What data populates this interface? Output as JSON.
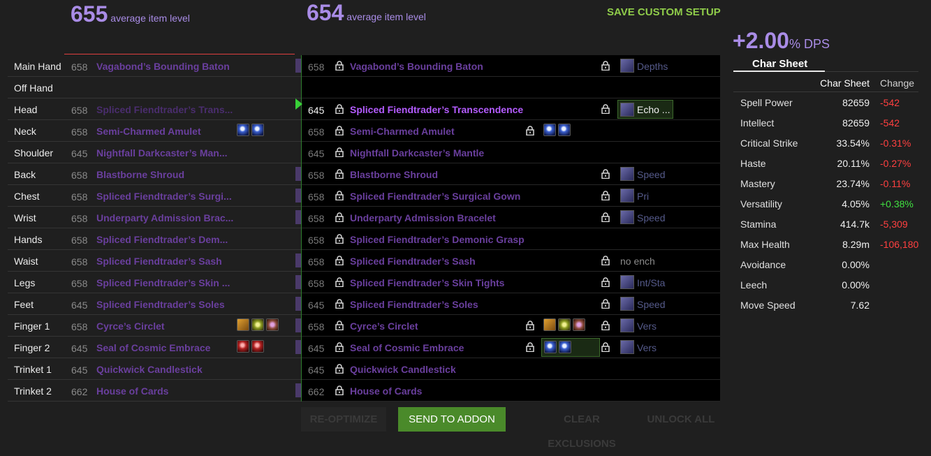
{
  "left_header": {
    "ilvl": "655",
    "label": "average item level"
  },
  "right_header": {
    "ilvl": "654",
    "label": "average item level"
  },
  "save_custom_label": "SAVE CUSTOM SETUP",
  "left_rows": [
    {
      "slot": "Main Hand",
      "ilvl": "658",
      "name": "Vagabond’s Bounding Baton",
      "gems": [],
      "cut": true
    },
    {
      "slot": "Off Hand",
      "ilvl": "",
      "name": "",
      "gems": [],
      "cut": false
    },
    {
      "slot": "Head",
      "ilvl": "658",
      "name": "Spliced Fiendtrader’s Trans...",
      "gems": [],
      "cut": false
    },
    {
      "slot": "Neck",
      "ilvl": "658",
      "name": "Semi-Charmed Amulet",
      "gems": [
        "blue",
        "blue"
      ],
      "cut": false
    },
    {
      "slot": "Shoulder",
      "ilvl": "645",
      "name": "Nightfall Darkcaster’s Man...",
      "gems": [],
      "cut": false
    },
    {
      "slot": "Back",
      "ilvl": "658",
      "name": "Blastborne Shroud",
      "gems": [],
      "cut": true
    },
    {
      "slot": "Chest",
      "ilvl": "658",
      "name": "Spliced Fiendtrader’s Surgi...",
      "gems": [],
      "cut": true
    },
    {
      "slot": "Wrist",
      "ilvl": "658",
      "name": "Underparty Admission Brac...",
      "gems": [],
      "cut": true
    },
    {
      "slot": "Hands",
      "ilvl": "658",
      "name": "Spliced Fiendtrader’s Dem...",
      "gems": [],
      "cut": false
    },
    {
      "slot": "Waist",
      "ilvl": "658",
      "name": "Spliced Fiendtrader’s Sash",
      "gems": [],
      "cut": true
    },
    {
      "slot": "Legs",
      "ilvl": "658",
      "name": "Spliced Fiendtrader’s Skin ...",
      "gems": [],
      "cut": true
    },
    {
      "slot": "Feet",
      "ilvl": "645",
      "name": "Spliced Fiendtrader’s Soles",
      "gems": [],
      "cut": true
    },
    {
      "slot": "Finger 1",
      "ilvl": "658",
      "name": "Cyrce’s Circlet",
      "gems": [
        "gold",
        "lime",
        "purp"
      ],
      "cut": true
    },
    {
      "slot": "Finger 2",
      "ilvl": "645",
      "name": "Seal of Cosmic Embrace",
      "gems": [
        "red",
        "red"
      ],
      "cut": true
    },
    {
      "slot": "Trinket 1",
      "ilvl": "645",
      "name": "Quickwick Candlestick",
      "gems": [],
      "cut": false
    },
    {
      "slot": "Trinket 2",
      "ilvl": "662",
      "name": "House of Cards",
      "gems": [],
      "cut": true
    }
  ],
  "right_rows": [
    {
      "ilvl": "658",
      "name": "Vagabond’s Bounding Baton",
      "changed": false,
      "gems": [],
      "gem_lock": false,
      "gem_box": false,
      "ench_lock": true,
      "ench_icon": true,
      "ench": "Depths",
      "ench_box": false,
      "ench_plain": false
    },
    {
      "ilvl": "",
      "name": "",
      "changed": false,
      "gems": [],
      "gem_lock": false,
      "gem_box": false,
      "ench_lock": false,
      "ench_icon": false,
      "ench": "",
      "ench_box": false,
      "ench_plain": false
    },
    {
      "ilvl": "645",
      "name": "Spliced Fiendtrader’s Transcendence",
      "changed": true,
      "gems": [],
      "gem_lock": false,
      "gem_box": false,
      "ench_lock": true,
      "ench_icon": true,
      "ench": "Echo ...",
      "ench_box": true,
      "ench_plain": false
    },
    {
      "ilvl": "658",
      "name": "Semi-Charmed Amulet",
      "changed": false,
      "gems": [
        "blue",
        "blue"
      ],
      "gem_lock": true,
      "gem_box": false,
      "ench_lock": false,
      "ench_icon": false,
      "ench": "",
      "ench_box": false,
      "ench_plain": false
    },
    {
      "ilvl": "645",
      "name": "Nightfall Darkcaster’s Mantle",
      "changed": false,
      "gems": [],
      "gem_lock": false,
      "gem_box": false,
      "ench_lock": false,
      "ench_icon": false,
      "ench": "",
      "ench_box": false,
      "ench_plain": false
    },
    {
      "ilvl": "658",
      "name": "Blastborne Shroud",
      "changed": false,
      "gems": [],
      "gem_lock": false,
      "gem_box": false,
      "ench_lock": true,
      "ench_icon": true,
      "ench": "Speed",
      "ench_box": false,
      "ench_plain": false
    },
    {
      "ilvl": "658",
      "name": "Spliced Fiendtrader’s Surgical Gown",
      "changed": false,
      "gems": [],
      "gem_lock": false,
      "gem_box": false,
      "ench_lock": true,
      "ench_icon": true,
      "ench": "Pri",
      "ench_box": false,
      "ench_plain": false
    },
    {
      "ilvl": "658",
      "name": "Underparty Admission Bracelet",
      "changed": false,
      "gems": [],
      "gem_lock": false,
      "gem_box": false,
      "ench_lock": true,
      "ench_icon": true,
      "ench": "Speed",
      "ench_box": false,
      "ench_plain": false
    },
    {
      "ilvl": "658",
      "name": "Spliced Fiendtrader’s Demonic Grasp",
      "changed": false,
      "gems": [],
      "gem_lock": false,
      "gem_box": false,
      "ench_lock": false,
      "ench_icon": false,
      "ench": "",
      "ench_box": false,
      "ench_plain": false
    },
    {
      "ilvl": "658",
      "name": "Spliced Fiendtrader’s Sash",
      "changed": false,
      "gems": [],
      "gem_lock": false,
      "gem_box": false,
      "ench_lock": true,
      "ench_icon": false,
      "ench": "no ench",
      "ench_box": false,
      "ench_plain": true
    },
    {
      "ilvl": "658",
      "name": "Spliced Fiendtrader’s Skin Tights",
      "changed": false,
      "gems": [],
      "gem_lock": false,
      "gem_box": false,
      "ench_lock": true,
      "ench_icon": true,
      "ench": "Int/Sta",
      "ench_box": false,
      "ench_plain": false
    },
    {
      "ilvl": "645",
      "name": "Spliced Fiendtrader’s Soles",
      "changed": false,
      "gems": [],
      "gem_lock": false,
      "gem_box": false,
      "ench_lock": true,
      "ench_icon": true,
      "ench": "Speed",
      "ench_box": false,
      "ench_plain": false
    },
    {
      "ilvl": "658",
      "name": "Cyrce’s Circlet",
      "changed": false,
      "gems": [
        "gold",
        "lime",
        "purp"
      ],
      "gem_lock": true,
      "gem_box": false,
      "ench_lock": true,
      "ench_icon": true,
      "ench": "Vers",
      "ench_box": false,
      "ench_plain": false
    },
    {
      "ilvl": "645",
      "name": "Seal of Cosmic Embrace",
      "changed": false,
      "gems": [
        "blue",
        "blue"
      ],
      "gem_lock": true,
      "gem_box": true,
      "ench_lock": true,
      "ench_icon": true,
      "ench": "Vers",
      "ench_box": false,
      "ench_plain": false
    },
    {
      "ilvl": "645",
      "name": "Quickwick Candlestick",
      "changed": false,
      "gems": [],
      "gem_lock": false,
      "gem_box": false,
      "ench_lock": false,
      "ench_icon": false,
      "ench": "",
      "ench_box": false,
      "ench_plain": false
    },
    {
      "ilvl": "662",
      "name": "House of Cards",
      "changed": false,
      "gems": [],
      "gem_lock": false,
      "gem_box": false,
      "ench_lock": false,
      "ench_icon": false,
      "ench": "",
      "ench_box": false,
      "ench_plain": false
    }
  ],
  "dps": {
    "value": "+2.00",
    "suffix": "% DPS"
  },
  "char_sheet": {
    "tab": "Char Sheet",
    "col_value": "Char Sheet",
    "col_change": "Change",
    "stats": [
      {
        "name": "Spell Power",
        "value": "82659",
        "change": "-542",
        "dir": "neg"
      },
      {
        "name": "Intellect",
        "value": "82659",
        "change": "-542",
        "dir": "neg"
      },
      {
        "name": "Critical Strike",
        "value": "33.54%",
        "change": "-0.31%",
        "dir": "neg"
      },
      {
        "name": "Haste",
        "value": "20.11%",
        "change": "-0.27%",
        "dir": "neg"
      },
      {
        "name": "Mastery",
        "value": "23.74%",
        "change": "-0.11%",
        "dir": "neg"
      },
      {
        "name": "Versatility",
        "value": "4.05%",
        "change": "+0.38%",
        "dir": "pos"
      },
      {
        "name": "Stamina",
        "value": "414.7k",
        "change": "-5,309",
        "dir": "neg"
      },
      {
        "name": "Max Health",
        "value": "8.29m",
        "change": "-106,180",
        "dir": "neg"
      },
      {
        "name": "Avoidance",
        "value": "0.00%",
        "change": "",
        "dir": ""
      },
      {
        "name": "Leech",
        "value": "0.00%",
        "change": "",
        "dir": ""
      },
      {
        "name": "Move Speed",
        "value": "7.62",
        "change": "",
        "dir": ""
      }
    ]
  },
  "buttons": {
    "reoptimize": "RE-OPTIMIZE",
    "send": "SEND TO ADDON",
    "clear": "CLEAR EXCLUSIONS",
    "unlock": "UNLOCK ALL"
  },
  "colors": {
    "accent_purple": "#a98ce6",
    "item_epic": "#6a3f9e",
    "item_changed": "#b45cff",
    "save_green": "#8fcc4a",
    "send_green": "#4a8a2a",
    "negative": "#ff4040",
    "positive": "#40e040"
  }
}
